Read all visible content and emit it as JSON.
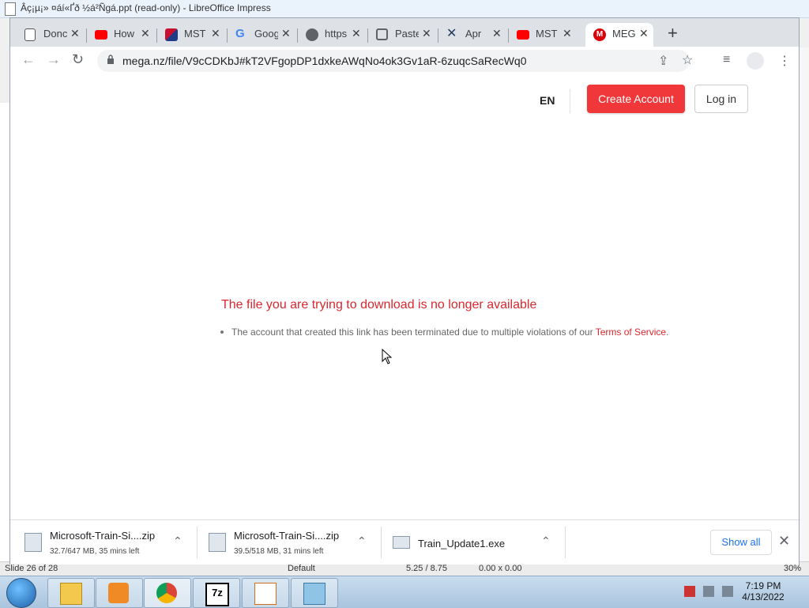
{
  "background_window": {
    "title": "Âç¡µ¡» ¤áí«Ґð ½á²Ñgá.ppt (read-only) - LibreOffice Impress",
    "status": {
      "slide": "Slide 26 of 28",
      "layout": "Default",
      "position": "5.25 / 8.75",
      "size": "0.00 x 0.00",
      "zoom": "30%"
    }
  },
  "browser": {
    "tabs": [
      {
        "label": "Donc",
        "icon": "document-icon"
      },
      {
        "label": "How",
        "icon": "youtube-icon"
      },
      {
        "label": "MST",
        "icon": "mst-icon"
      },
      {
        "label": "Goog",
        "icon": "google-icon"
      },
      {
        "label": "https",
        "icon": "globe-icon"
      },
      {
        "label": "Paste",
        "icon": "paste-icon"
      },
      {
        "label": "Apr",
        "icon": "apr-icon"
      },
      {
        "label": "MST",
        "icon": "youtube-icon"
      },
      {
        "label": "MEG",
        "icon": "mega-icon"
      }
    ],
    "url": "mega.nz/file/V9cCDKbJ#kT2VFgopDP1dxkeAWqNo4ok3Gv1aR-6zuqcSaRecWq0"
  },
  "page": {
    "lang": "EN",
    "create_account": "Create Account",
    "login": "Log in",
    "error_title": "The file you are trying to download is no longer available",
    "error_detail": "The account that created this link has been terminated due to multiple violations of our ",
    "tos_link": "Terms of Service",
    "tos_suffix": "."
  },
  "downloads": [
    {
      "name": "Microsoft-Train-Si....zip",
      "meta": "32.7/647 MB, 35 mins left"
    },
    {
      "name": "Microsoft-Train-Si....zip",
      "meta": "39.5/518 MB, 31 mins left"
    },
    {
      "name": "Train_Update1.exe",
      "meta": ""
    }
  ],
  "shelf": {
    "show_all": "Show all"
  },
  "taskbar": {
    "time": "7:19 PM",
    "date": "4/13/2022"
  },
  "colors": {
    "mega_red": "#f0373a",
    "error_red": "#d9272e",
    "link_blue": "#1a73e8"
  }
}
